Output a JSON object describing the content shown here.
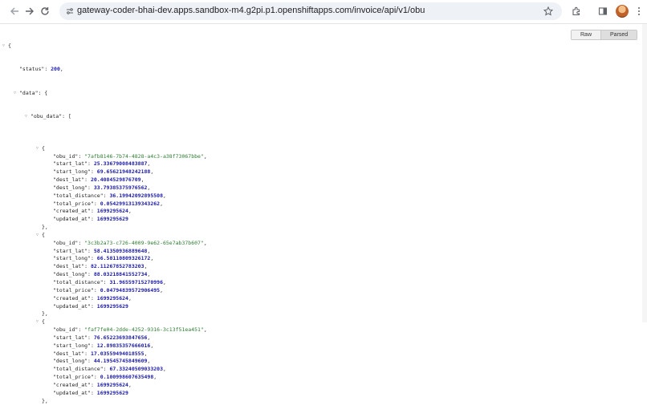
{
  "browser": {
    "url": "gateway-coder-bhai-dev.apps.sandbox-m4.g2pi.p1.openshiftapps.com/invoice/api/v1/obu",
    "icons": [
      "back-arrow-icon",
      "forward-arrow-icon",
      "reload-icon",
      "site-info-icon",
      "star-icon",
      "extensions-icon",
      "side-panel-icon",
      "profile-avatar"
    ]
  },
  "viewer": {
    "raw_label": "Raw",
    "parsed_label": "Parsed"
  },
  "json": {
    "status": 200,
    "obu_data": [
      {
        "obu_id": "\"7afb8146-7b74-4828-a4c3-a38f73067bbe\"",
        "start_lat": "25.33679008483887",
        "start_long": "69.65621948242188",
        "dest_lat": "20.4084529876709",
        "dest_long": "33.79385375976562",
        "total_distance": "36.19942092895508",
        "total_price": "0.05429913139343262",
        "created_at": "1699295624",
        "updated_at": "1699295629"
      },
      {
        "obu_id": "\"3c3b2a73-c726-4009-9e62-65e7ab37b607\"",
        "start_lat": "58.41350936889648",
        "start_long": "66.58110809326172",
        "dest_lat": "82.11267852783203",
        "dest_long": "88.03218841552734",
        "total_distance": "31.96559715270996",
        "total_price": "0.04794839572906495",
        "created_at": "1699295624",
        "updated_at": "1699295629"
      },
      {
        "obu_id": "\"faf7fe04-2dde-4252-9316-3c13f51ea451\"",
        "start_lat": "76.65223693847656",
        "start_long": "12.89835357666016",
        "dest_lat": "17.03559494018555",
        "dest_long": "44.19545745849609",
        "total_distance": "67.33240509033203",
        "total_price": "0.100998607635498",
        "created_at": "1699295624",
        "updated_at": "1699295629"
      }
    ]
  }
}
